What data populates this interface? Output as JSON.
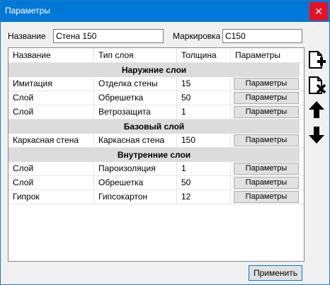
{
  "window": {
    "title": "Параметры",
    "close": "✕"
  },
  "form": {
    "name_label": "Название",
    "name_value": "Стена 150",
    "mark_label": "Маркировка",
    "mark_value": "С150"
  },
  "table": {
    "headers": [
      "Название",
      "Тип слоя",
      "Толщина",
      "Параметры"
    ],
    "groups": [
      {
        "title": "Наружние слои",
        "rows": [
          {
            "name": "Имитация",
            "type": "Отделка стены",
            "thickness": "15",
            "button": "Параметры"
          },
          {
            "name": "Слой",
            "type": "Обрешетка",
            "thickness": "50",
            "button": "Параметры"
          },
          {
            "name": "Слой",
            "type": "Ветрозащита",
            "thickness": "1",
            "button": "Параметры"
          }
        ]
      },
      {
        "title": "Базовый слой",
        "rows": [
          {
            "name": "Каркасная стена",
            "type": "Каркасная стена",
            "thickness": "150",
            "button": "Параметры"
          }
        ]
      },
      {
        "title": "Внутренние слои",
        "rows": [
          {
            "name": "Слой",
            "type": "Пароизоляция",
            "thickness": "1",
            "button": "Параметры"
          },
          {
            "name": "Слой",
            "type": "Обрешетка",
            "thickness": "50",
            "button": "Параметры"
          },
          {
            "name": "Гипрок",
            "type": "Гипсокартон",
            "thickness": "12",
            "button": "Параметры"
          }
        ]
      }
    ]
  },
  "sidebar_buttons": [
    "add-layer-icon",
    "delete-layer-icon",
    "move-up-icon",
    "move-down-icon"
  ],
  "apply_label": "Применить"
}
